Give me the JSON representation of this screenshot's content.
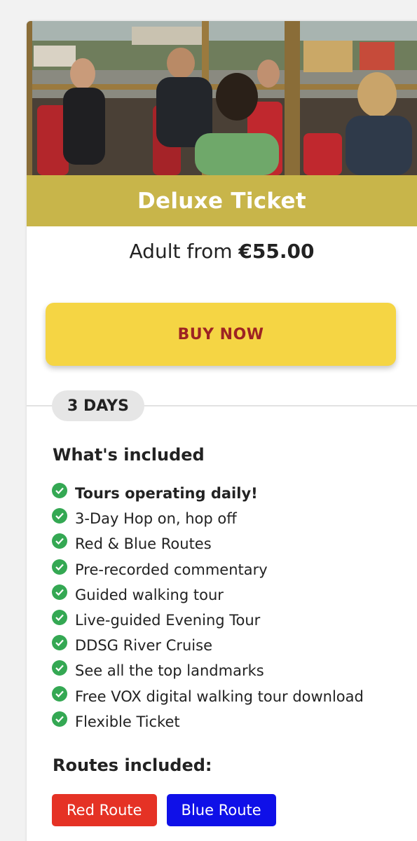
{
  "ticket": {
    "title": "Deluxe Ticket",
    "price_prefix": "Adult from",
    "price": "€55.00",
    "buy_label": "BUY NOW",
    "duration": "3 DAYS"
  },
  "included": {
    "heading": "What's included",
    "items": [
      "Tours operating daily!",
      "3-Day Hop on, hop off",
      "Red & Blue Routes",
      "Pre-recorded commentary",
      "Guided walking tour",
      "Live-guided Evening Tour",
      "DDSG River Cruise",
      "See all the top landmarks",
      "Free VOX digital walking tour download",
      "Flexible Ticket"
    ]
  },
  "routes": {
    "heading": "Routes included:",
    "tags": [
      {
        "label": "Red Route",
        "color": "#e53225"
      },
      {
        "label": "Blue Route",
        "color": "#0f10e8"
      }
    ]
  },
  "colors": {
    "title_band": "#c8b54a",
    "buy_button": "#f5d544",
    "buy_text": "#9d2323",
    "check": "#34a853"
  },
  "icons": {
    "feature_check": "check-circle-icon"
  }
}
